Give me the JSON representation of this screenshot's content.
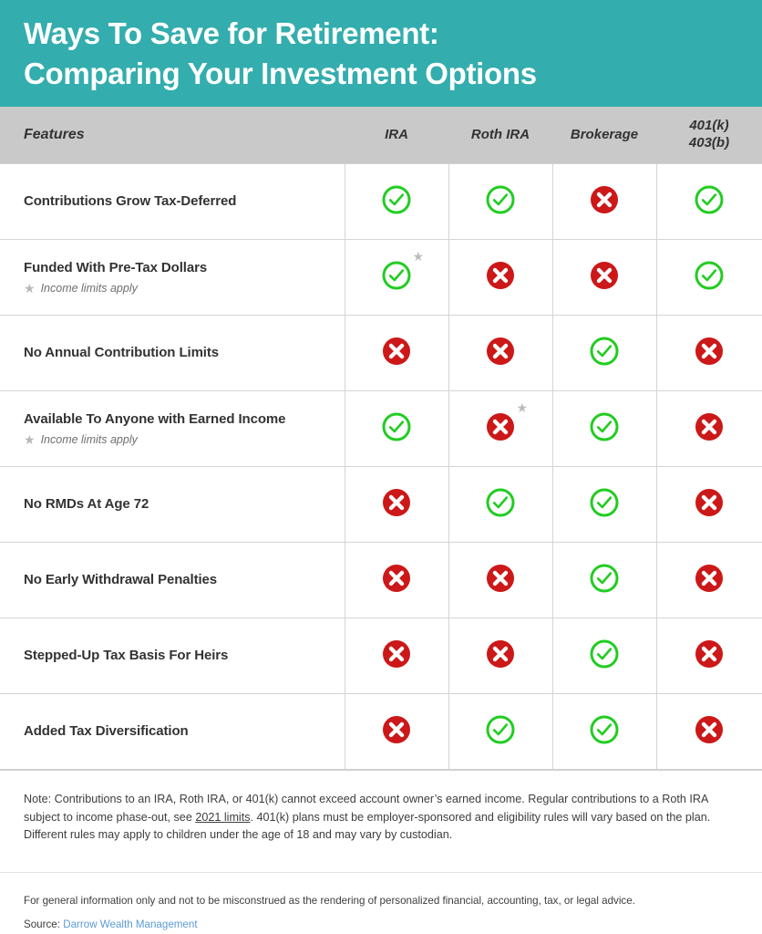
{
  "banner": {
    "title": "Ways To Save for Retirement:\nComparing Your Investment Options",
    "background_color": "#33adad",
    "text_color": "#ffffff"
  },
  "colors": {
    "teal": "#33adad",
    "header_gray": "#c9c9c9",
    "yes_green": "#22cc22",
    "no_red": "#cc1818",
    "star_gray": "#bcbcbc",
    "link_blue": "#5b9bd5"
  },
  "table": {
    "columns": [
      {
        "label": "Features",
        "key": "feature"
      },
      {
        "label": "IRA",
        "key": "ira"
      },
      {
        "label": "Roth IRA",
        "key": "roth_ira"
      },
      {
        "label": "Brokerage",
        "key": "brokerage"
      },
      {
        "label": "401(k)\n403(b)",
        "key": "employer_plan"
      }
    ],
    "rows": [
      {
        "label": "Contributions Grow Tax-Deferred",
        "note": null,
        "values": [
          "yes",
          "yes",
          "no",
          "yes"
        ],
        "stars": [
          false,
          false,
          false,
          false
        ]
      },
      {
        "label": "Funded With Pre-Tax Dollars",
        "note": "Income limits apply",
        "values": [
          "yes",
          "no",
          "no",
          "yes"
        ],
        "stars": [
          true,
          false,
          false,
          false
        ]
      },
      {
        "label": "No Annual Contribution Limits",
        "note": null,
        "values": [
          "no",
          "no",
          "yes",
          "no"
        ],
        "stars": [
          false,
          false,
          false,
          false
        ]
      },
      {
        "label": "Available To Anyone with Earned Income",
        "note": "Income limits apply",
        "values": [
          "yes",
          "no",
          "yes",
          "no"
        ],
        "stars": [
          false,
          true,
          false,
          false
        ]
      },
      {
        "label": "No RMDs At Age 72",
        "note": null,
        "values": [
          "no",
          "yes",
          "yes",
          "no"
        ],
        "stars": [
          false,
          false,
          false,
          false
        ]
      },
      {
        "label": "No Early Withdrawal Penalties",
        "note": null,
        "values": [
          "no",
          "no",
          "yes",
          "no"
        ],
        "stars": [
          false,
          false,
          false,
          false
        ]
      },
      {
        "label": "Stepped-Up Tax Basis For Heirs",
        "note": null,
        "values": [
          "no",
          "no",
          "yes",
          "no"
        ],
        "stars": [
          false,
          false,
          false,
          false
        ]
      },
      {
        "label": "Added Tax Diversification",
        "note": null,
        "values": [
          "no",
          "yes",
          "yes",
          "no"
        ],
        "stars": [
          false,
          false,
          false,
          false
        ]
      }
    ]
  },
  "footer": {
    "note_part1": "Note: Contributions to an IRA, Roth IRA, or 401(k) cannot exceed account owner’s earned income. Regular contributions to a Roth IRA subject to income phase-out, see ",
    "note_link": "2021 limits",
    "note_part2": ". 401(k) plans must be employer-sponsored and eligibility rules will vary based on the plan. Different rules may apply to children under the age of 18 and may vary by custodian.",
    "disclaimer": "For general information only and not to be misconstrued as the rendering of personalized financial, accounting, tax, or legal advice.",
    "source_label": "Source:",
    "source_link": "Darrow Wealth Management"
  },
  "icons": {
    "yes": "check-circle-icon",
    "no": "x-circle-icon",
    "star": "star-icon",
    "star_glyph": "★"
  }
}
